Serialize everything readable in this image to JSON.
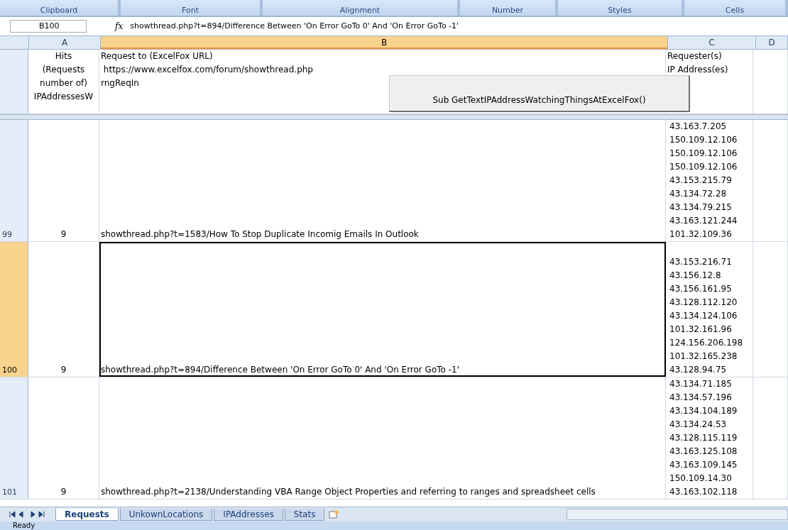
{
  "ribbon_groups": [
    "Clipboard",
    "Font",
    "Alignment",
    "Number",
    "Styles",
    "Cells"
  ],
  "formula_bar": {
    "name_box": "B100",
    "fx": "fx",
    "formula": "showthread.php?t=894/Difference Between 'On Error GoTo 0' And 'On Error GoTo -1'"
  },
  "columns": [
    {
      "label": "A",
      "selected": false
    },
    {
      "label": "B",
      "selected": true
    },
    {
      "label": "C",
      "selected": false
    },
    {
      "label": "D",
      "selected": false
    }
  ],
  "header_row": {
    "col_a": [
      "Hits",
      "(Requests",
      "number of)",
      "IPAddressesW"
    ],
    "col_b": [
      "Request to (ExcelFox URL)",
      " https://www.excelfox.com/forum/showthread.php",
      "rngReqIn"
    ],
    "col_c": [
      "Requester(s)",
      "IP Address(es)"
    ]
  },
  "macro_button": "Sub GetTextIPAddressWatchingThingsAtExcelFox()",
  "rows": [
    {
      "number": "99",
      "hits": "9",
      "request": "showthread.php?t=1583/How To Stop Duplicate Incomig Emails In Outlook",
      "selected": false,
      "ips": [
        "43.163.7.205",
        "150.109.12.106",
        "150.109.12.106",
        "150.109.12.106",
        "43.153.215.79",
        "43.134.72.28",
        "43.134.79.215",
        "43.163.121.244",
        "101.32.109.36"
      ]
    },
    {
      "number": "100",
      "hits": "9",
      "request": "showthread.php?t=894/Difference Between 'On Error GoTo 0' And 'On Error GoTo -1'",
      "selected": true,
      "ips": [
        "43.153.216.71",
        "43.156.12.8",
        "43.156.161.95",
        "43.128.112.120",
        "43.134.124.106",
        "101.32.161.96",
        "124.156.206.198",
        "101.32.165.238",
        "43.128.94.75"
      ]
    },
    {
      "number": "101",
      "hits": "9",
      "request": "showthread.php?t=2138/Understanding VBA Range Object Properties and referring to ranges and spreadsheet cells",
      "selected": false,
      "ips": [
        "43.134.71.185",
        "43.134.57.196",
        "43.134.104.189",
        "43.134.24.53",
        "43.128.115.119",
        "43.163.125.108",
        "43.163.109.145",
        "150.109.14.30",
        "43.163.102.118"
      ]
    }
  ],
  "sheet_tabs": [
    {
      "label": "Requests",
      "selected": true
    },
    {
      "label": "UnkownLocations",
      "selected": false
    },
    {
      "label": "IPAddresses",
      "selected": false
    },
    {
      "label": "Stats",
      "selected": false
    }
  ],
  "status_bar": "Ready"
}
